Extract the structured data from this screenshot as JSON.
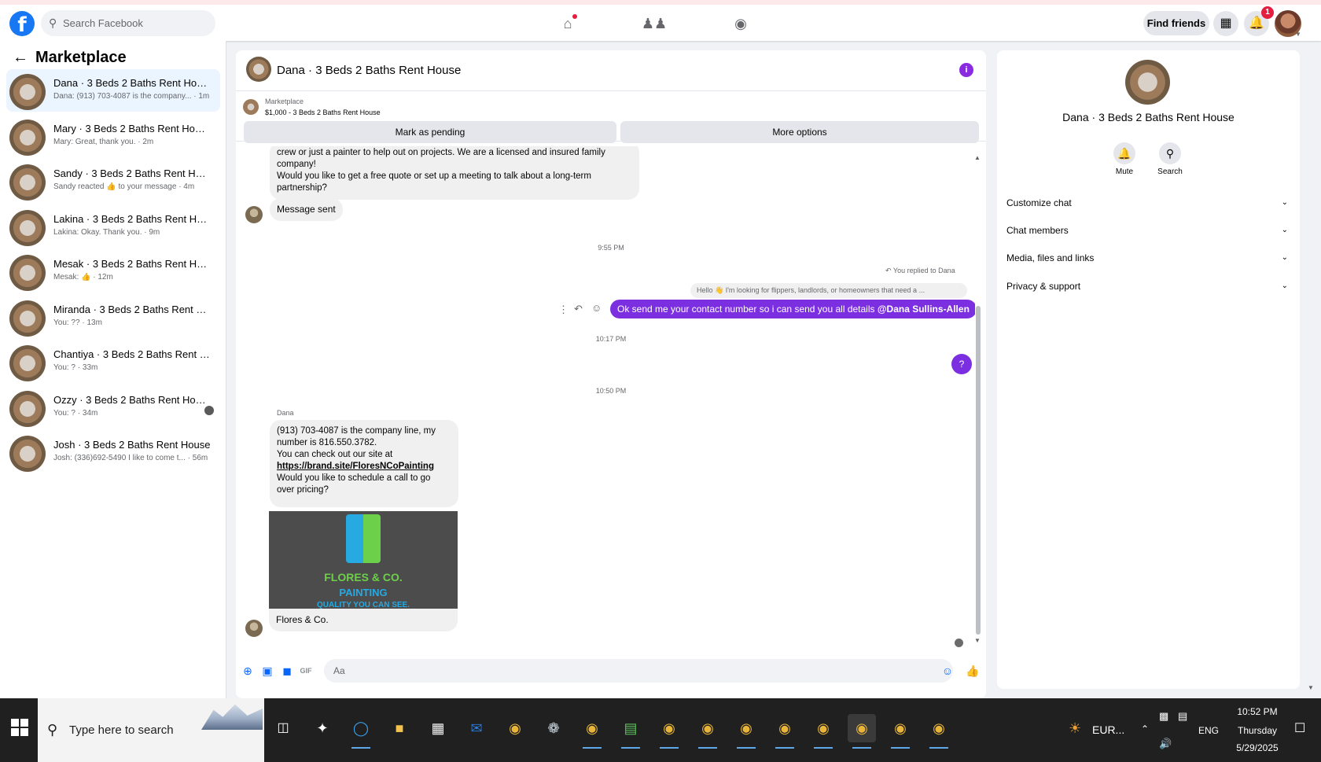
{
  "topbar": {
    "search_placeholder": "Search Facebook",
    "find_friends": "Find friends",
    "notifications_count": "1",
    "icons": [
      "facebook-logo",
      "home-icon",
      "friends-icon",
      "groups-icon",
      "apps-grid-icon",
      "bell-icon"
    ]
  },
  "sidebar": {
    "title": "Marketplace",
    "conversations": [
      {
        "title": "Dana · 3 Beds 2 Baths Rent House",
        "subtitle": "Dana: (913) 703-4087 is the company... · 1m",
        "active": true
      },
      {
        "title": "Mary · 3 Beds 2 Baths Rent House",
        "subtitle": "Mary: Great, thank you. · 2m"
      },
      {
        "title": "Sandy · 3 Beds 2 Baths Rent House",
        "subtitle": "Sandy reacted 👍 to your message · 4m"
      },
      {
        "title": "Lakina · 3 Beds 2 Baths Rent House",
        "subtitle": "Lakina: Okay. Thank you. · 9m"
      },
      {
        "title": "Mesak · 3 Beds 2 Baths Rent House",
        "subtitle": "Mesak: 👍 · 12m"
      },
      {
        "title": "Miranda · 3 Beds 2 Baths Rent Hou...",
        "subtitle": "You: ?? · 13m"
      },
      {
        "title": "Chantiya · 3 Beds 2 Baths Rent Ho...",
        "subtitle": "You: ? · 33m"
      },
      {
        "title": "Ozzy · 3 Beds 2 Baths Rent House",
        "subtitle": "You: ? · 34m"
      },
      {
        "title": "Josh · 3 Beds 2 Baths Rent House",
        "subtitle": "Josh: (336)692-5490 I like to come t... · 56m"
      }
    ]
  },
  "chat": {
    "title": "Dana · 3 Beds 2 Baths Rent House",
    "marketplace_label": "Marketplace",
    "listing": "$1,000 - 3 Beds 2 Baths Rent House",
    "mark_pending": "Mark as pending",
    "more_options": "More options",
    "first_bubble": {
      "line1": "crew or just a painter to help out on projects. We are a licensed and insured family",
      "line2": "company!",
      "line3": "Would you like to get a free quote or set up a meeting to talk about a long-term",
      "line4": "partnership?"
    },
    "message_sent": "Message sent",
    "ts1": "9:55 PM",
    "reply_ref": "You replied to Dana",
    "reply_preview": "Hello 👋 I'm looking for flippers, landlords, or homeowners that need a ...",
    "sent_message": "Ok send me your contact number so i can send you all details ",
    "sent_mention": "@Dana Sullins-Allen",
    "ts2": "10:17 PM",
    "question_mark": "?",
    "ts3": "10:50 PM",
    "sender_name": "Dana",
    "reply_bubble": {
      "line1": "(913) 703-4087 is the company line, my",
      "line2": "number is 816.550.3782.",
      "line3": "You can check out our site at",
      "link": "https://brand.site/FloresNCoPainting",
      "line4": "Would you like to schedule a call to go",
      "line5": "over pricing?"
    },
    "logo": {
      "line1": "FLORES & CO.",
      "line2": "PAINTING",
      "line3": "QUALITY YOU CAN SEE."
    },
    "logo_caption": "Flores & Co.",
    "composer_placeholder": "Aa"
  },
  "right_panel": {
    "title": "Dana · 3 Beds 2 Baths Rent House",
    "mute": "Mute",
    "search": "Search",
    "rows": [
      "Customize chat",
      "Chat members",
      "Media, files and links",
      "Privacy & support"
    ]
  },
  "taskbar": {
    "search_placeholder": "Type here to search",
    "weather": "EUR...",
    "lang": "ENG",
    "time": "10:52 PM",
    "day": "Thursday",
    "date": "5/29/2025"
  },
  "colors": {
    "accent": "#7b2fe0",
    "facebook_blue": "#1877f2",
    "active_conv": "#ebf5ff"
  }
}
